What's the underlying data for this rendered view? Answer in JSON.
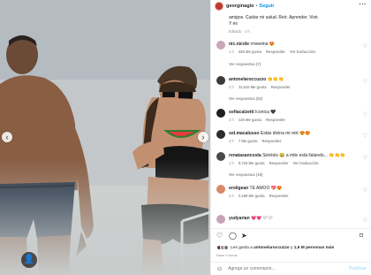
{
  "header": {
    "username": "georginagio",
    "separator": "•",
    "follow_label": "Seguir",
    "more_icon": "more-horizontal-icon"
  },
  "caption": {
    "text": "amigos. Cuidar mi salud. Reír. Aprender. Vivir.",
    "line2": "Y es",
    "edited": "Editado · 1 h"
  },
  "photo": {
    "prev_icon": "chevron-left-icon",
    "next_icon": "chevron-right-icon",
    "tag_icon": "user-tag-icon"
  },
  "comments": [
    {
      "user": "nic.nicole",
      "text": "rrreeeina 😍",
      "meta": [
        "1 h",
        "426 Me gusta",
        "Responder",
        "Ver traducción"
      ],
      "avatar_color": "#c9a7b5"
    },
    {
      "user": "antonelaroccuzzo",
      "text": "👏👏👏",
      "meta": [
        "2 h",
        "11.510 Me gusta",
        "Responder"
      ],
      "avatar_color": "#3b3b3b",
      "replies": "Ver respuestas (52)"
    },
    {
      "user": "sofiacalzetti",
      "text": "Iconica 🖤",
      "meta": [
        "2 h",
        "125 Me gusta",
        "Responder"
      ],
      "avatar_color": "#1f1f1f"
    },
    {
      "user": "sol.macalusso",
      "text": "Estás divina mi reiii 😍😍",
      "meta": [
        "2 h",
        "7 Me gusta",
        "Responder"
      ],
      "avatar_color": "#2c2c2c"
    },
    {
      "user": "renatasancosta",
      "text": "Séééxis 😂 a mile está llalando... 👏👏👏",
      "meta": [
        "1 h",
        "5.716 Me gusta",
        "Responder",
        "Ver traducción"
      ],
      "avatar_color": "#4a4a4a",
      "replies": "Ver respuestas (16)"
    },
    {
      "user": "eroligean",
      "text": "TE AMOO 💖😍",
      "meta": [
        "2 h",
        "2.199 Me gusta",
        "Responder"
      ],
      "avatar_color": "#d88a6a"
    },
    {
      "user": "yudyarian",
      "text": "💗💗🤍🤍",
      "meta": [],
      "avatar_color": "#c7a3b8"
    }
  ],
  "replies_first": "Ver respuestas (7)",
  "actions": {
    "like_icon": "heart-icon",
    "comment_icon": "comment-icon",
    "share_icon": "send-icon",
    "save_icon": "bookmark-icon"
  },
  "likes": {
    "prefix": "Les gusta a ",
    "user": "antonelaroccuzzo",
    "middle": " y ",
    "count": "1,6 M personas más"
  },
  "date": "Hace 5 horas",
  "add_comment": {
    "placeholder": "Agrega un comentario...",
    "publish_label": "Publicar",
    "emoji_icon": "smiley-icon"
  }
}
